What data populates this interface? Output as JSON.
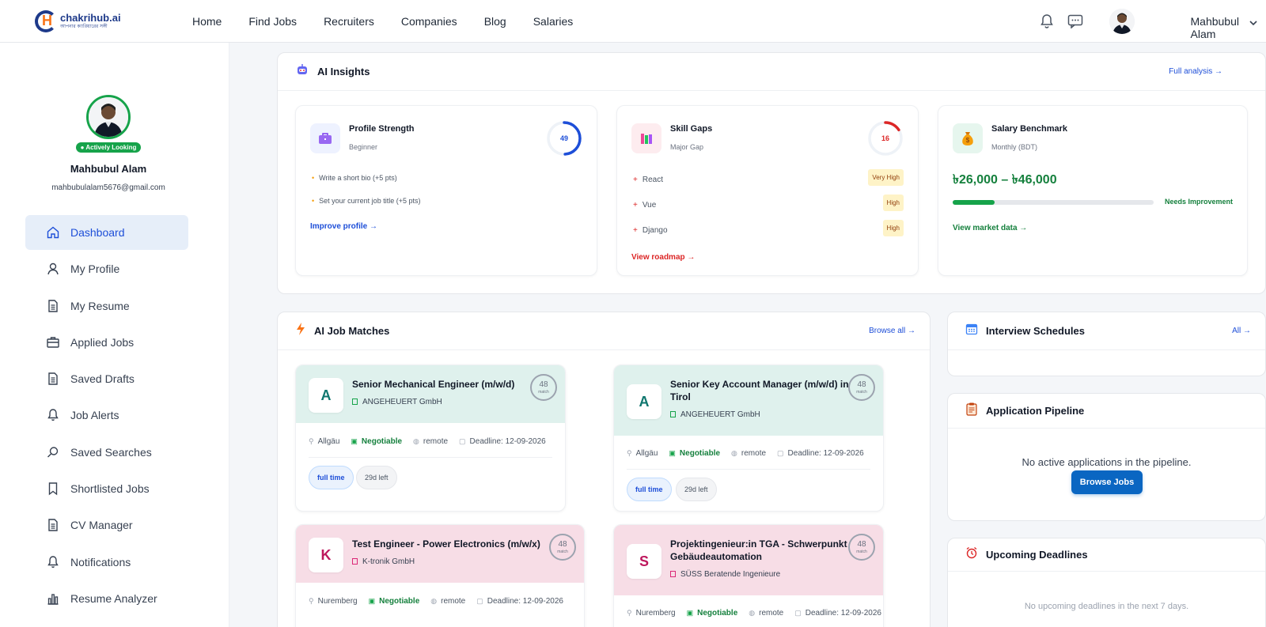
{
  "brand": {
    "name": "chakrihub.ai",
    "tagline": "আপনার ক্যারিয়ারের সঙ্গী"
  },
  "nav": {
    "links": [
      "Home",
      "Find Jobs",
      "Recruiters",
      "Companies",
      "Blog",
      "Salaries"
    ],
    "user_name": "Mahbubul Alam"
  },
  "profile": {
    "status": "● Actively Looking",
    "name": "Mahbubul Alam",
    "email": "mahbubulalam5676@gmail.com"
  },
  "sidebar": {
    "items": [
      {
        "label": "Dashboard",
        "icon": "home-icon"
      },
      {
        "label": "My Profile",
        "icon": "user-icon"
      },
      {
        "label": "My Resume",
        "icon": "document-icon"
      },
      {
        "label": "Applied Jobs",
        "icon": "briefcase-icon"
      },
      {
        "label": "Saved Drafts",
        "icon": "document-icon"
      },
      {
        "label": "Job Alerts",
        "icon": "bell-icon"
      },
      {
        "label": "Saved Searches",
        "icon": "search-icon"
      },
      {
        "label": "Shortlisted Jobs",
        "icon": "bookmark-icon"
      },
      {
        "label": "CV Manager",
        "icon": "document-icon"
      },
      {
        "label": "Notifications",
        "icon": "bell-icon"
      },
      {
        "label": "Resume Analyzer",
        "icon": "bar-chart-icon"
      }
    ]
  },
  "insights": {
    "title": "AI Insights",
    "link": "Full analysis →",
    "profile_strength": {
      "title": "Profile Strength",
      "sub": "Beginner",
      "score": "49",
      "score_value": 49,
      "tips": [
        "Write a short bio (+5 pts)",
        "Set your current job title (+5 pts)"
      ],
      "link": "Improve profile →"
    },
    "skill_gaps": {
      "title": "Skill Gaps",
      "sub": "Major Gap",
      "score": "16",
      "score_value": 16,
      "gaps": [
        {
          "skill": "React",
          "level": "Very High"
        },
        {
          "skill": "Vue",
          "level": "High"
        },
        {
          "skill": "Django",
          "level": "High"
        }
      ],
      "link": "View roadmap →"
    },
    "salary": {
      "title": "Salary Benchmark",
      "sub": "Monthly (BDT)",
      "range": "৳26,000 – ৳46,000",
      "status": "Needs Improvement",
      "progress": 0.21,
      "link": "View market data →"
    }
  },
  "matches": {
    "title": "AI Job Matches",
    "link": "Browse all →",
    "jobs": [
      {
        "letter": "A",
        "title": "Senior Mechanical Engineer (m/w/d)",
        "company": "ANGEHEUERT GmbH",
        "match": "48",
        "match_label": "match",
        "location": "Allgäu",
        "salary": "Negotiable",
        "mode": "remote",
        "deadline": "Deadline: 12-09-2026",
        "type": "full time",
        "left": "29d left"
      },
      {
        "letter": "A",
        "title": "Senior Key Account Manager (m/w/d) in Tirol",
        "company": "ANGEHEUERT GmbH",
        "match": "48",
        "match_label": "match",
        "location": "Allgäu",
        "salary": "Negotiable",
        "mode": "remote",
        "deadline": "Deadline: 12-09-2026",
        "type": "full time",
        "left": "29d left"
      },
      {
        "letter": "K",
        "title": "Test Engineer - Power Electronics (m/w/x)",
        "company": "K-tronik GmbH",
        "match": "48",
        "match_label": "match",
        "location": "Nuremberg",
        "salary": "Negotiable",
        "mode": "remote",
        "deadline": "Deadline: 12-09-2026"
      },
      {
        "letter": "S",
        "title": "Projektingenieur:in TGA - Schwerpunkt Gebäudeautomation",
        "company": "SÜSS Beratende Ingenieure",
        "match": "48",
        "match_label": "match",
        "location": "Nuremberg",
        "salary": "Negotiable",
        "mode": "remote",
        "deadline": "Deadline: 12-09-2026"
      }
    ]
  },
  "interviews": {
    "title": "Interview Schedules",
    "link": "All →"
  },
  "pipeline": {
    "title": "Application Pipeline",
    "empty": "No active applications in the pipeline.",
    "button": "Browse Jobs"
  },
  "deadlines": {
    "title": "Upcoming Deadlines",
    "empty": "No upcoming deadlines in the next 7 days."
  },
  "colors": {
    "primary": "#0a66c2",
    "accent_green": "#16a34a",
    "danger": "#dc2626"
  }
}
